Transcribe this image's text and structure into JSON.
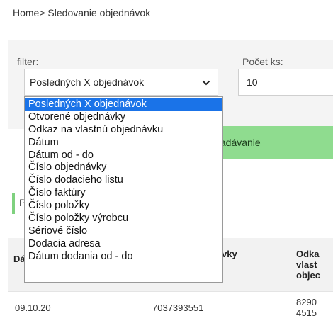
{
  "breadcrumb": {
    "home": "Home",
    "separator": ">",
    "current": " Sledovanie objednávok"
  },
  "filter": {
    "label": "filter:",
    "selected": "Posledných X objednávok",
    "options": [
      "Posledných X objednávok",
      "Otvorené objednávky",
      "Odkaz na vlastnú objednávku",
      "Dátum",
      "Dátum od - do",
      "Číslo objednávky",
      "Číslo dodacieho listu",
      "Číslo faktúry",
      "Číslo položky",
      "Číslo položky výrobcu",
      "Sériové číslo",
      "Dodacia adresa",
      "Dátum dodania od - do"
    ]
  },
  "count": {
    "label": "Počet ks:",
    "value": "10"
  },
  "search": {
    "label": "yhľadávanie"
  },
  "section": {
    "title": "P"
  },
  "table": {
    "headers": [
      "Dá",
      "vky",
      "Odka\nvlast\nobjec"
    ],
    "rows": [
      [
        "09.10.20",
        "7037393551",
        "8290\n4515"
      ]
    ]
  },
  "colors": {
    "accent_green": "#8fdc8f",
    "selected_blue": "#1a73e8"
  }
}
